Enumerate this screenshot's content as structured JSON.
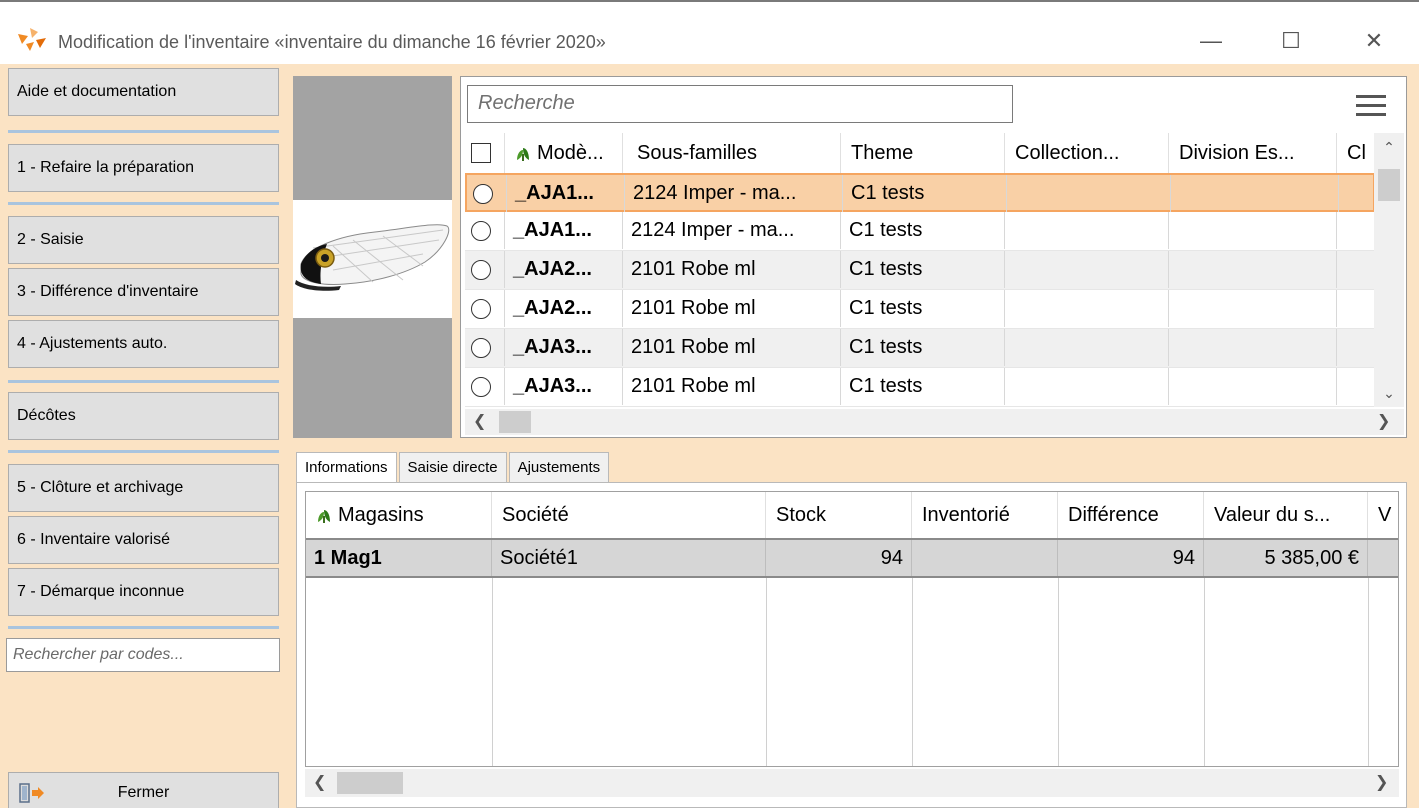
{
  "window": {
    "title": "Modification de l'inventaire «inventaire du dimanche 16 février 2020»",
    "minimize": "—",
    "maximize": "☐",
    "close": "✕"
  },
  "sidebar": {
    "buttons": [
      {
        "label": "Aide et documentation"
      },
      {
        "label": "1 - Refaire la préparation"
      },
      {
        "label": "2 - Saisie"
      },
      {
        "label": "3 - Différence d'inventaire"
      },
      {
        "label": "4 - Ajustements auto."
      },
      {
        "label": "Décôtes"
      },
      {
        "label": "5 - Clôture et archivage"
      },
      {
        "label": "6 - Inventaire valorisé"
      },
      {
        "label": "7 - Démarque inconnue"
      }
    ],
    "search_placeholder": "Rechercher par codes...",
    "close_label": "Fermer"
  },
  "product_grid": {
    "search_placeholder": "Recherche",
    "columns": [
      "Modè...",
      "Sous-familles",
      "Theme",
      "Collection...",
      "Division Es...",
      "Cl"
    ],
    "rows": [
      {
        "model": "_AJA1...",
        "sub_family": "2124 Imper - ma...",
        "theme": "C1 tests"
      },
      {
        "model": "_AJA1...",
        "sub_family": "2124 Imper - ma...",
        "theme": "C1 tests"
      },
      {
        "model": "_AJA2...",
        "sub_family": "2101 Robe ml",
        "theme": "C1 tests"
      },
      {
        "model": "_AJA2...",
        "sub_family": "2101 Robe ml",
        "theme": "C1 tests"
      },
      {
        "model": "_AJA3...",
        "sub_family": "2101 Robe ml",
        "theme": "C1 tests"
      },
      {
        "model": "_AJA3...",
        "sub_family": "2101 Robe ml",
        "theme": "C1 tests"
      }
    ],
    "selected_row": 0
  },
  "tabs": [
    {
      "label": "Informations"
    },
    {
      "label": "Saisie directe"
    },
    {
      "label": "Ajustements"
    }
  ],
  "info_grid": {
    "columns": [
      "Magasins",
      "Société",
      "Stock",
      "Inventorié",
      "Différence",
      "Valeur du s...",
      "V"
    ],
    "rows": [
      {
        "store": "1 Mag1",
        "company": "Société1",
        "stock": "94",
        "inventoried": "",
        "difference": "94",
        "value": "5 385,00 €"
      }
    ]
  },
  "colors": {
    "background": "#fbe3c4",
    "selected_row": "#f9d0a6",
    "selected_border": "#f5a560",
    "separator": "#a9c4de"
  }
}
